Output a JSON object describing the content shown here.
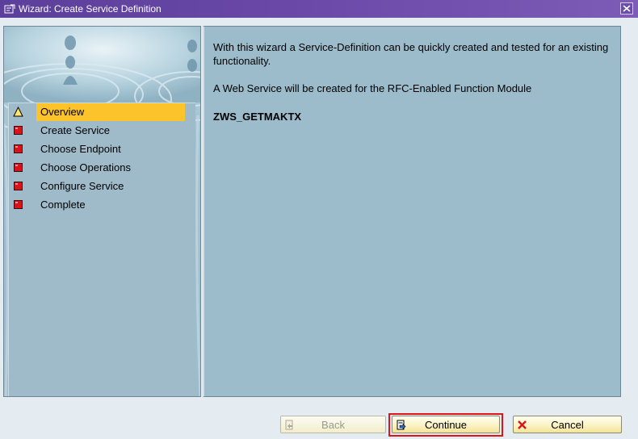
{
  "window": {
    "title": "Wizard: Create Service Definition",
    "title_icon": "wizard-window-icon",
    "close_icon": "close-icon"
  },
  "steps": [
    {
      "label": "Overview",
      "icon": "warning-triangle-icon",
      "active": true
    },
    {
      "label": "Create Service",
      "icon": "red-square-icon",
      "active": false
    },
    {
      "label": "Choose Endpoint",
      "icon": "red-square-icon",
      "active": false
    },
    {
      "label": "Choose Operations",
      "icon": "red-square-icon",
      "active": false
    },
    {
      "label": "Configure Service",
      "icon": "red-square-icon",
      "active": false
    },
    {
      "label": "Complete",
      "icon": "red-square-icon",
      "active": false
    }
  ],
  "content": {
    "intro": "With this wizard a Service-Definition can be quickly created and tested for an existing functionality.",
    "rfc_line": "A Web Service will be created for the RFC-Enabled Function Module",
    "function_module": "ZWS_GETMAKTX"
  },
  "buttons": {
    "back": "Back",
    "continue": "Continue",
    "cancel": "Cancel"
  },
  "colors": {
    "title_bar": "#5b3f9a",
    "panel_bg": "#9cbccb",
    "active_step": "#fdc32b",
    "highlight_border": "#e0141b"
  }
}
